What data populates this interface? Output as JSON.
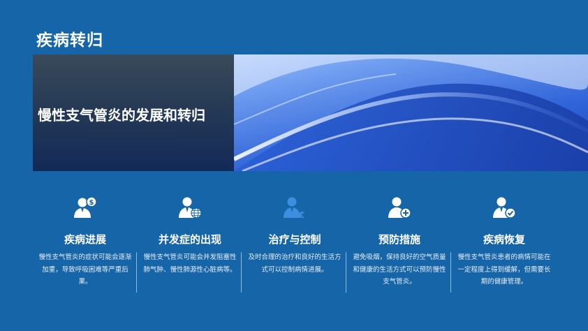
{
  "page": {
    "title": "疾病转归"
  },
  "banner": {
    "title": "慢性支气管炎的发展和转归"
  },
  "features": [
    {
      "icon": "person-dollar-icon",
      "title": "疾病进展",
      "desc": "慢性支气管炎的症状可能会逐渐加重，导致呼吸困难等严重后果。"
    },
    {
      "icon": "person-globe-icon",
      "title": "并发症的出现",
      "desc": "慢性支气管炎可能会并发阻塞性肺气肿、慢性肺源性心脏病等。"
    },
    {
      "icon": "person-euro-icon",
      "title": "治疗与控制",
      "desc": "及时合理的治疗和良好的生活方式可以控制病情进展。"
    },
    {
      "icon": "person-plus-icon",
      "title": "预防措施",
      "desc": "避免吸烟，保持良好的空气质量和健康的生活方式可以预防慢性支气管炎。"
    },
    {
      "icon": "person-check-icon",
      "title": "疾病恢复",
      "desc": "慢性支气管炎患者的病情可能在一定程度上得到缓解，但需要长期的健康管理。"
    }
  ]
}
